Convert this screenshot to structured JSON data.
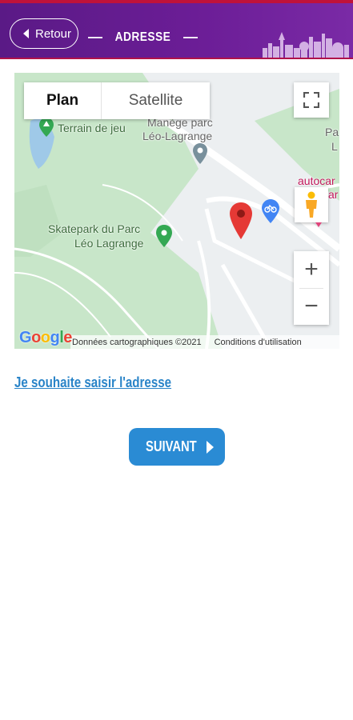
{
  "header": {
    "back_label": "Retour",
    "title": "ADRESSE",
    "brand_color": "#5a1a86"
  },
  "map": {
    "type_plan": "Plan",
    "type_satellite": "Satellite",
    "selected_type": "Plan",
    "labels": {
      "playground": "Terrain de jeu",
      "carousel_line1": "Manège parc",
      "carousel_line2": "Léo-Lagrange",
      "skatepark_line1": "Skatepark du Parc",
      "skatepark_line2": "Léo Lagrange",
      "autocar_line1": "autocar",
      "autocar_line2": "ar",
      "edge_line1": "Pa",
      "edge_line2": "L"
    },
    "google_logo": "Google",
    "attribution": "Données cartographiques ©2021",
    "terms": "Conditions d'utilisation",
    "zoom_in": "+",
    "zoom_out": "−",
    "icons": [
      "fullscreen-icon",
      "pegman-icon",
      "location-pin-icon",
      "bicycle-icon",
      "park-marker-icon"
    ]
  },
  "manual_link": "Je souhaite saisir l'adresse",
  "next_button": "SUIVANT",
  "colors": {
    "accent_blue": "#2a8bd4",
    "link_blue": "#2a84c8",
    "pin_red": "#e53935"
  }
}
